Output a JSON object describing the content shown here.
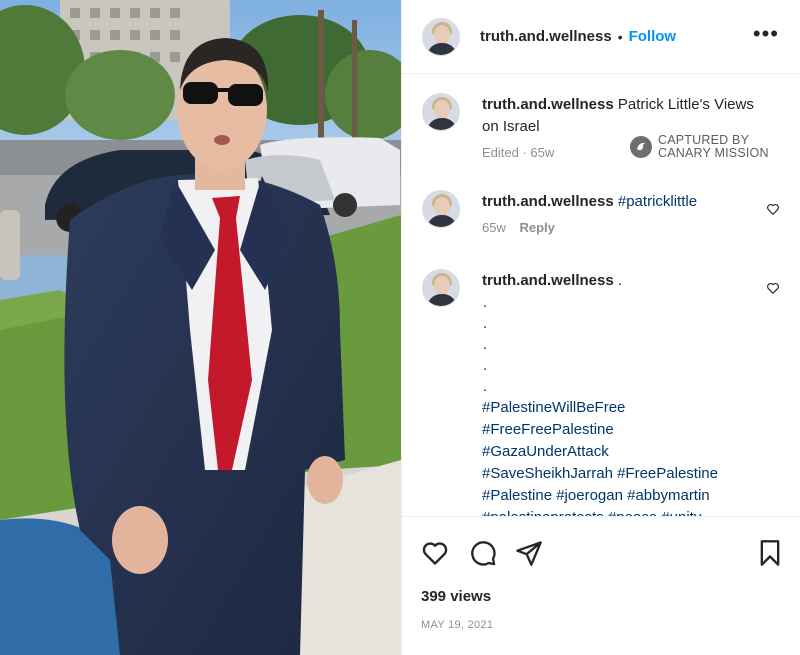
{
  "post": {
    "username": "truth.and.wellness",
    "separator": "•",
    "follow_label": "Follow",
    "more_label": "•••"
  },
  "watermark": {
    "line1": "CAPTURED BY",
    "line2": "CANARY MISSION"
  },
  "comments": [
    {
      "username": "truth.and.wellness",
      "text": "Patrick Little's Views on Israel",
      "meta_time": "Edited · 65w"
    },
    {
      "username": "truth.and.wellness",
      "text": "#patricklittle",
      "meta_time": "65w",
      "reply_label": "Reply"
    },
    {
      "username": "truth.and.wellness",
      "text": ".",
      "dots": [
        ".",
        ".",
        ".",
        ".",
        "."
      ],
      "hashtags": [
        "#PalestineWillBeFree",
        "#FreeFreePalestine",
        "#GazaUnderAttack",
        "#SaveSheikhJarrah #FreePalestine",
        "#Palestine #joerogan #abbymartin",
        "#palestineprotests #peace #unity"
      ]
    }
  ],
  "footer": {
    "views": "399 views",
    "date": "MAY 19, 2021"
  },
  "icons": {
    "like": "heart-icon",
    "comment": "comment-icon",
    "share": "share-icon",
    "save": "bookmark-icon",
    "more": "more-icon"
  },
  "colors": {
    "link_blue": "#0095f6",
    "hashtag": "#00376b",
    "muted": "#8e8e8e",
    "text": "#262626"
  }
}
